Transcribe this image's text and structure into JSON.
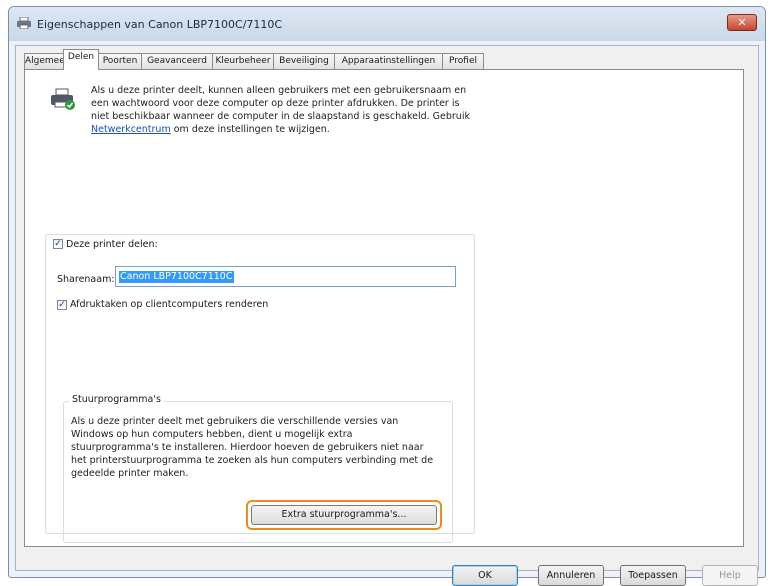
{
  "window": {
    "title": "Eigenschappen van Canon LBP7100C/7110C",
    "close_label": "✕"
  },
  "tabs": [
    {
      "label": "Algemeen"
    },
    {
      "label": "Delen"
    },
    {
      "label": "Poorten"
    },
    {
      "label": "Geavanceerd"
    },
    {
      "label": "Kleurbeheer"
    },
    {
      "label": "Beveiliging"
    },
    {
      "label": "Apparaatinstellingen"
    },
    {
      "label": "Profiel"
    }
  ],
  "active_tab": "Delen",
  "intro": {
    "text": "Als u deze printer deelt, kunnen alleen gebruikers met een gebruikersnaam en een wachtwoord voor deze computer op deze printer afdrukken. De printer is niet beschikbaar wanneer de computer in de slaapstand is geschakeld. Gebruik",
    "link": "Netwerkcentrum",
    "text_after": "om deze instellingen te wijzigen."
  },
  "share": {
    "checkbox_label": "Deze printer delen:",
    "checked": true,
    "name_label": "Sharenaam:",
    "name_value": "Canon LBP7100C7110C",
    "render_label": "Afdruktaken op clientcomputers renderen",
    "render_checked": true
  },
  "drivers": {
    "group_title": "Stuurprogramma's",
    "text": "Als u deze printer deelt met gebruikers die verschillende versies van Windows op hun computers hebben, dient u mogelijk extra stuurprogramma's te installeren. Hierdoor hoeven de gebruikers niet naar het printerstuurprogramma te zoeken als hun computers verbinding met de gedeelde printer maken.",
    "button_label": "Extra stuurprogramma's...",
    "highlight_color": "#ee8b1f"
  },
  "footer": {
    "ok": "OK",
    "cancel": "Annuleren",
    "apply": "Toepassen",
    "help": "Help"
  }
}
